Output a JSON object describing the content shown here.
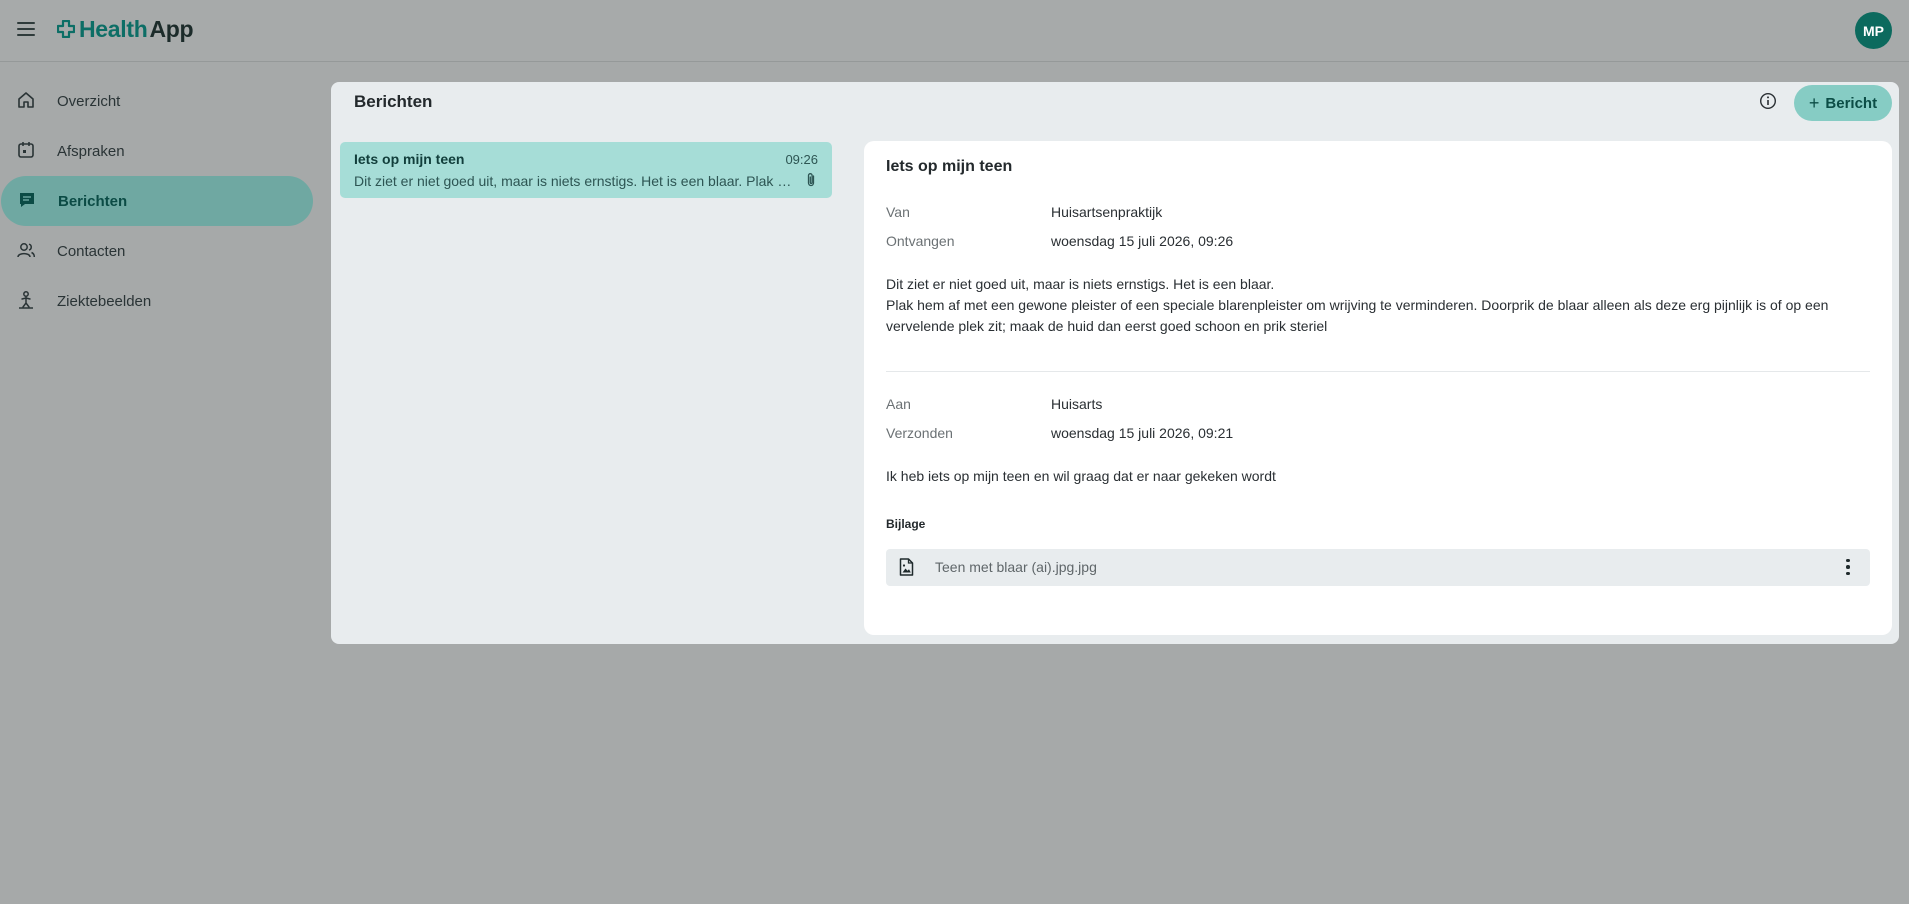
{
  "app": {
    "logo_part1": "Health",
    "logo_part2": "App",
    "user_initials": "MP"
  },
  "sidebar": {
    "items": [
      {
        "label": "Overzicht",
        "icon": "home-icon"
      },
      {
        "label": "Afspraken",
        "icon": "calendar-icon"
      },
      {
        "label": "Berichten",
        "icon": "message-icon",
        "active": true
      },
      {
        "label": "Contacten",
        "icon": "contacts-icon"
      },
      {
        "label": "Ziektebeelden",
        "icon": "medical-icon"
      }
    ]
  },
  "panel": {
    "title": "Berichten",
    "new_button_label": "Bericht"
  },
  "message_list": [
    {
      "subject": "Iets op mijn teen",
      "time": "09:26",
      "preview": "Dit ziet er niet goed uit, maar is niets ernstigs. Het is een blaar.  Plak hem af met een gewone pleister of een speciale blarenpleister",
      "has_attachment": true
    }
  ],
  "detail": {
    "subject": "Iets op mijn teen",
    "received": {
      "from_label": "Van",
      "from_value": "Huisartsenpraktijk",
      "date_label": "Ontvangen",
      "date_value": "woensdag 15 juli 2026, 09:26",
      "body_line1": "Dit ziet er niet goed uit, maar is niets ernstigs. Het is een blaar.",
      "body_line2": "Plak hem af met een gewone pleister of een speciale blarenpleister om wrijving te verminderen. Doorprik de blaar alleen als deze erg pijnlijk is of op een vervelende plek zit; maak de huid dan eerst goed schoon en prik steriel"
    },
    "sent": {
      "to_label": "Aan",
      "to_value": "Huisarts",
      "date_label": "Verzonden",
      "date_value": "woensdag 15 juli 2026, 09:21",
      "body": "Ik heb iets op mijn teen en wil graag dat er naar gekeken wordt"
    },
    "attachment": {
      "heading": "Bijlage",
      "file_name": "Teen met blaar (ai).jpg.jpg"
    }
  },
  "colors": {
    "brand": "#0d6e66",
    "active_nav": "#6fa8a2",
    "selected_message": "#a6ddd7",
    "primary_button": "#86ccc4"
  }
}
